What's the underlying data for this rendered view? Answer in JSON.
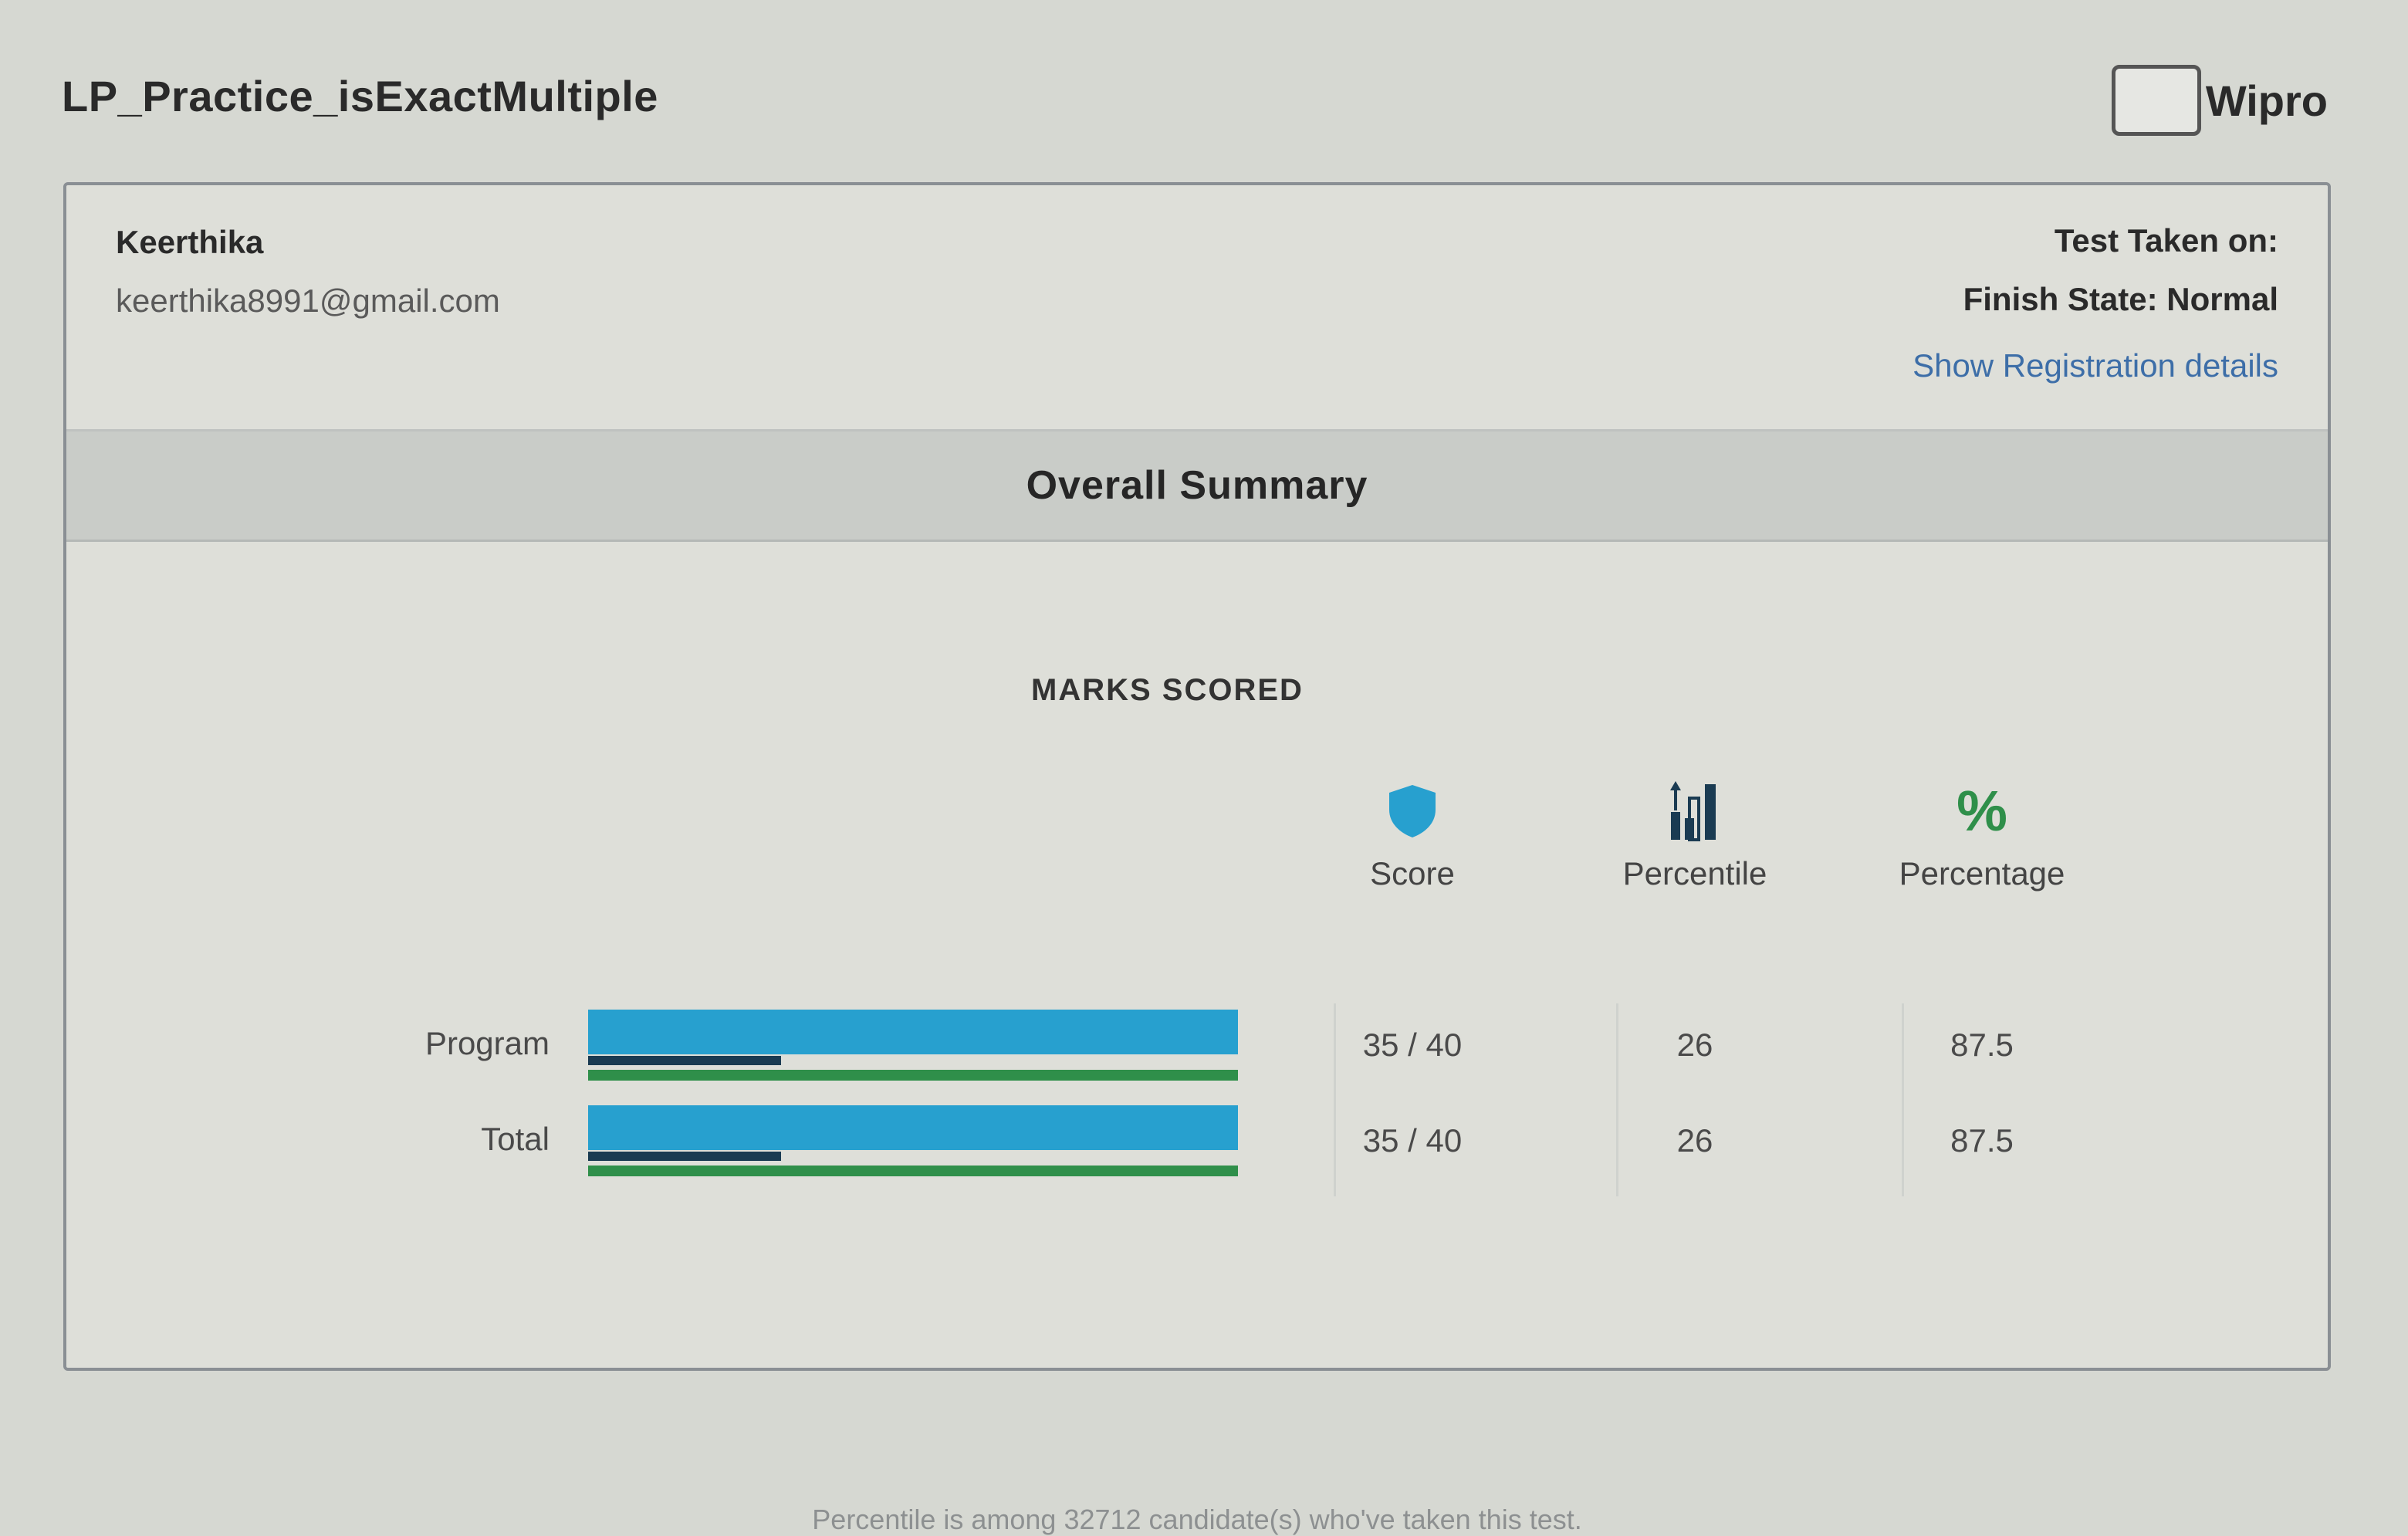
{
  "header": {
    "test_title": "LP_Practice_isExactMultiple",
    "brand_name": "Wipro"
  },
  "candidate": {
    "name": "Keerthika",
    "email": "keerthika8991@gmail.com"
  },
  "test_info": {
    "test_taken_label": "Test Taken on:",
    "finish_state_label": "Finish State: Normal",
    "show_registration_link": "Show Registration details"
  },
  "summary": {
    "title": "Overall Summary",
    "marks_title": "MARKS SCORED",
    "columns": {
      "score": "Score",
      "percentile": "Percentile",
      "percentage": "Percentage"
    },
    "icons": {
      "score": "shield-icon",
      "percentile": "bar-chart-icon",
      "percentage": "percent-icon"
    },
    "rows": [
      {
        "label": "Program",
        "score": "35 / 40",
        "percentile": "26",
        "percentage": "87.5",
        "score_fraction": 0.875,
        "percentile_fraction": 0.26,
        "percentage_fraction": 0.875
      },
      {
        "label": "Total",
        "score": "35 / 40",
        "percentile": "26",
        "percentage": "87.5",
        "score_fraction": 0.875,
        "percentile_fraction": 0.26,
        "percentage_fraction": 0.875
      }
    ],
    "footnote": "Percentile is among 32712 candidate(s) who've taken this test.",
    "colors": {
      "score_bar": "#27a0cf",
      "percentile_bar": "#1a3b52",
      "percentage_bar": "#2f8f4a",
      "link": "#3d6ea8"
    }
  }
}
